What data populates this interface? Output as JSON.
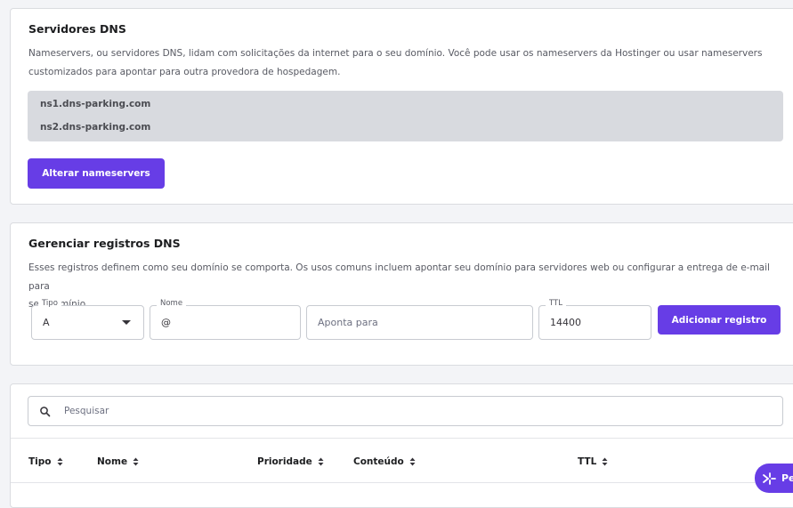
{
  "dns_servers": {
    "title": "Servidores DNS",
    "description_line1": "Nameservers, ou servidores DNS, lidam com solicitações da internet para o seu domínio. Você pode usar os nameservers da Hostinger ou usar nameservers",
    "description_line2": "customizados para apontar para outra provedora de hospedagem.",
    "nameservers": [
      "ns1.dns-parking.com",
      "ns2.dns-parking.com"
    ],
    "change_button": "Alterar nameservers"
  },
  "manage_records": {
    "title": "Gerenciar registros DNS",
    "description_line1": "Esses registros definem como seu domínio se comporta. Os usos comuns incluem apontar seu domínio para servidores web ou configurar a entrega de e-mail para",
    "description_line2": "seu domínio.",
    "type_field": {
      "label": "Tipo",
      "value": "A"
    },
    "name_field": {
      "label": "Nome",
      "value": "@"
    },
    "points_to_field": {
      "placeholder": "Aponta para"
    },
    "ttl_field": {
      "label": "TTL",
      "value": "14400"
    },
    "add_button": "Adicionar registro"
  },
  "records_table": {
    "search_placeholder": "Pesquisar",
    "columns": [
      "Tipo",
      "Nome",
      "Prioridade",
      "Conteúdo",
      "TTL"
    ]
  },
  "chat_widget": {
    "label": "Pe"
  },
  "colors": {
    "accent": "#673de6",
    "page_background": "#f3f4f7",
    "nameserver_box": "#d8dadf"
  }
}
